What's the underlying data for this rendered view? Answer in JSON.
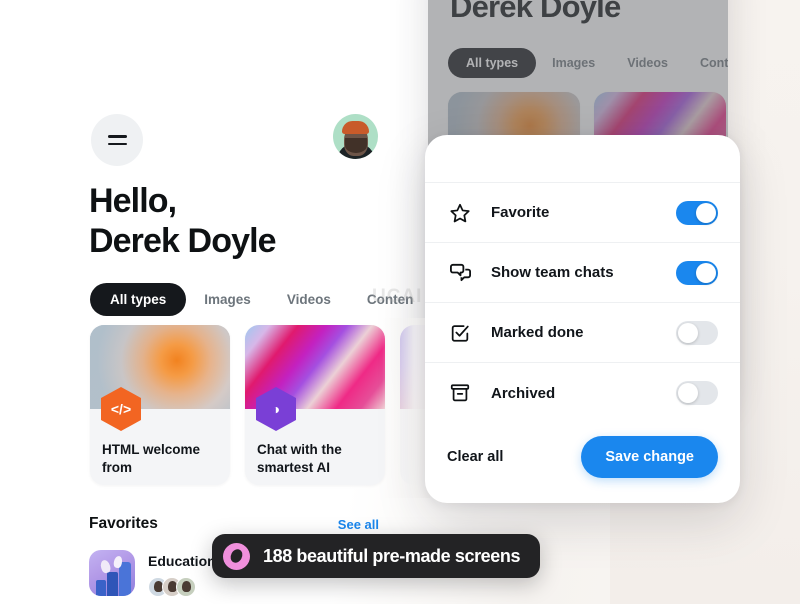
{
  "colors": {
    "accent_blue": "#1a87ee",
    "dark": "#15181c",
    "toggle_off": "#e3e6ea",
    "toast_bg": "#232325",
    "toast_icon": "#f08fdc",
    "badge_orange": "#f26522",
    "badge_purple": "#7a3fd6",
    "avatar_bg": "#aedfc6"
  },
  "front_screen": {
    "menu_icon": "hamburger-icon",
    "avatar_icon": "user-avatar",
    "greeting_line1": "Hello,",
    "greeting_line2": "Derek Doyle",
    "tabs": [
      {
        "label": "All types",
        "active": true
      },
      {
        "label": "Images",
        "active": false
      },
      {
        "label": "Videos",
        "active": false
      },
      {
        "label": "Conten",
        "active": false
      }
    ],
    "cards": [
      {
        "title": "HTML welcome from",
        "icon": "code-icon",
        "icon_glyph": "</>",
        "badge_color": "#f26522"
      },
      {
        "title": "Chat with the smartest AI",
        "icon": "contrast-circle-icon",
        "icon_glyph": "◑",
        "badge_color": "#7a3fd6"
      }
    ],
    "favorites": {
      "title": "Favorites",
      "see_all": "See all",
      "item_name": "Education",
      "member_count": 3
    },
    "watermark": "UCAI"
  },
  "back_screen": {
    "greeting": "Derek Doyle",
    "tabs": [
      {
        "label": "All types",
        "active": true
      },
      {
        "label": "Images",
        "active": false
      },
      {
        "label": "Videos",
        "active": false
      },
      {
        "label": "Conten",
        "active": false
      }
    ]
  },
  "modal": {
    "rows": [
      {
        "label": "Favorite",
        "icon": "star-icon",
        "on": true
      },
      {
        "label": "Show team chats",
        "icon": "chat-bubbles-icon",
        "on": true
      },
      {
        "label": "Marked done",
        "icon": "checkbox-checked-icon",
        "on": false
      },
      {
        "label": "Archived",
        "icon": "archive-box-icon",
        "on": false
      }
    ],
    "clear_label": "Clear all",
    "save_label": "Save change"
  },
  "toast": {
    "icon": "pill-icon",
    "text": "188 beautiful pre-made screens"
  }
}
